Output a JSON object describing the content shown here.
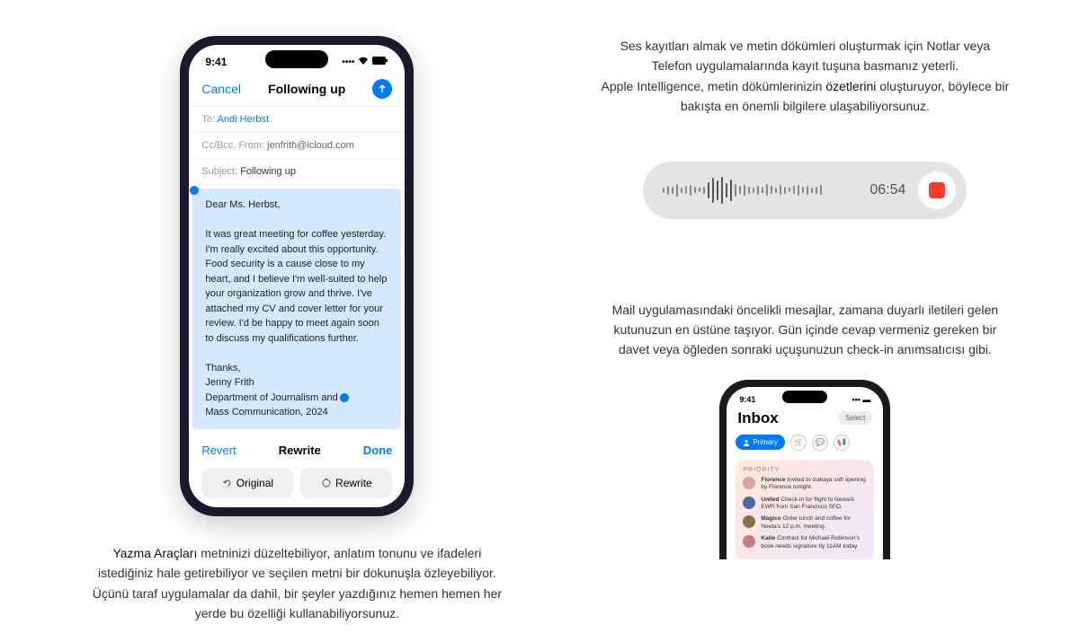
{
  "phone1": {
    "time": "9:41",
    "cancel": "Cancel",
    "title": "Following up",
    "to_label": "To:",
    "to_value": "Andi Herbst",
    "cc_label": "Cc/Bcc, From:",
    "cc_value": "jenfrith@icloud.com",
    "subject_label": "Subject:",
    "subject_value": "Following up",
    "body_greeting": "Dear Ms. Herbst,",
    "body_p1": "It was great meeting for coffee yesterday. I'm really excited about this opportunity. Food security is a cause close to my heart, and I believe I'm well-suited to help your organization grow and thrive. I've attached my CV and cover letter for your review. I'd be happy to meet again soon to discuss my qualifications further.",
    "body_sign1": "Thanks,",
    "body_sign2": "Jenny Frith",
    "body_sign3": "Department of Journalism and",
    "body_sign4": "Mass Communication, 2024",
    "revert": "Revert",
    "rewrite": "Rewrite",
    "done": "Done",
    "btn_original": "Original",
    "btn_rewrite": "Rewrite"
  },
  "caption_left": {
    "lead": "Yazma Araçları",
    "rest": " metninizi düzeltebiliyor, anlatım tonunu ve ifadeleri istediğiniz hale getirebiliyor ve seçilen metni bir dokunuşla özleyebiliyor. Üçünü taraf uygulamalar da dahil, bir şeyler yazdığınız hemen hemen her yerde bu özelliği kullanabiliyorsunuz."
  },
  "caption_right_top": {
    "line1": "Ses kayıtları almak ve metin dökümleri oluşturmak için Notlar veya Telefon uygulamalarında kayıt tuşuna basmanız yeterli.",
    "line2a": "Apple Intelligence, metin dökümlerinizin ",
    "line2b": "özetlerini",
    "line2c": " oluşturuyor, böylece bir bakışta en önemli bilgilere ulaşabiliyorsunuz."
  },
  "recorder": {
    "time": "06:54"
  },
  "caption_right_mid": {
    "lead": "Mail uygulamasındaki öncelikli mesajlar",
    "rest": ", zamana duyarlı iletileri gelen kutunuzun en üstüne taşıyor. Gün içinde cevap vermeniz gereken bir davet veya öğleden sonraki uçuşunuzun check-in anımsatıcısı gibi."
  },
  "phone2": {
    "time": "9:41",
    "title": "Inbox",
    "select": "Select",
    "primary": "Primary",
    "priority_label": "PRIORITY",
    "items": [
      {
        "name": "Florence",
        "text": "Invited to izakaya soft opening by Florence tonight.",
        "color": "#d4a5a5"
      },
      {
        "name": "United",
        "text": "Check-in for flight to Newark EWR from San Francisco SFO.",
        "color": "#4a6da7"
      },
      {
        "name": "Magico",
        "text": "Order lunch and coffee for Neeta's 12 p.m. meeting.",
        "color": "#8b6f47"
      },
      {
        "name": "Katie",
        "text": "Contract for Michael Robinson's book needs signature by 11AM today.",
        "color": "#c97d7d"
      }
    ]
  }
}
